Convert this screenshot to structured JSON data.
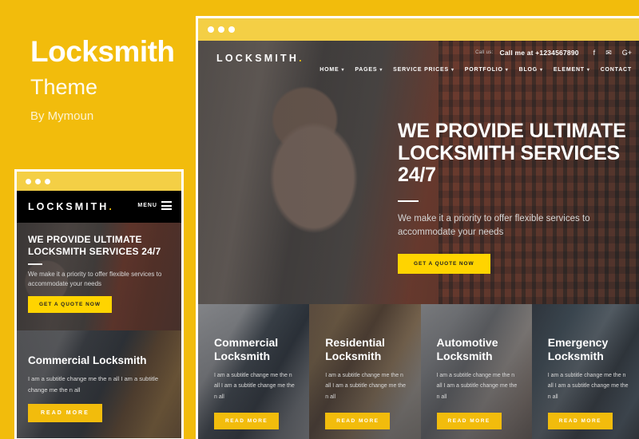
{
  "colors": {
    "page_background": "#f2bc0c",
    "window_bar": "#f4cf45",
    "accent_yellow": "#ffd400",
    "button_yellow": "#f2bc0c",
    "header_dark": "#000000"
  },
  "promo": {
    "title": "Locksmith",
    "subtitle": "Theme",
    "author": "By Mymoun"
  },
  "site": {
    "logo": "LOCKSMITH",
    "logo_dot": ".",
    "call_label": "Call us:",
    "call_number": "Call me at +1234567890",
    "social": [
      {
        "name": "facebook-icon",
        "glyph": "f"
      },
      {
        "name": "twitter-icon",
        "glyph": "✉"
      },
      {
        "name": "google-plus-icon",
        "glyph": "G+"
      }
    ],
    "nav": [
      {
        "label": "HOME",
        "caret": "▾"
      },
      {
        "label": "PAGES",
        "caret": "▾"
      },
      {
        "label": "SERVICE PRICES",
        "caret": "▾"
      },
      {
        "label": "PORTFOLIO",
        "caret": "▾"
      },
      {
        "label": "BLOG",
        "caret": "▾"
      },
      {
        "label": "ELEMENT",
        "caret": "▾"
      },
      {
        "label": "CONTACT",
        "caret": ""
      }
    ],
    "mobile_menu_label": "MENU",
    "hero": {
      "title": "WE PROVIDE ULTIMATE LOCKSMITH SERVICES 24/7",
      "text": "We make it a priority to offer flexible services to accommodate your needs",
      "cta": "GET A QUOTE NOW"
    },
    "cards": [
      {
        "title": "Commercial Locksmith",
        "text": "I am a subtitle change me the n all I am a subtitle change me the n all",
        "button": "READ MORE"
      },
      {
        "title": "Residential Locksmith",
        "text": "I am a subtitle change me the n all I am a subtitle change me the n all",
        "button": "READ MORE"
      },
      {
        "title": "Automotive Locksmith",
        "text": "I am a subtitle change me the n all I am a subtitle change me the n all",
        "button": "READ MORE"
      },
      {
        "title": "Emergency Locksmith",
        "text": "I am a subtitle change me the n all I am a subtitle change me the n all",
        "button": "READ MORE"
      }
    ]
  }
}
